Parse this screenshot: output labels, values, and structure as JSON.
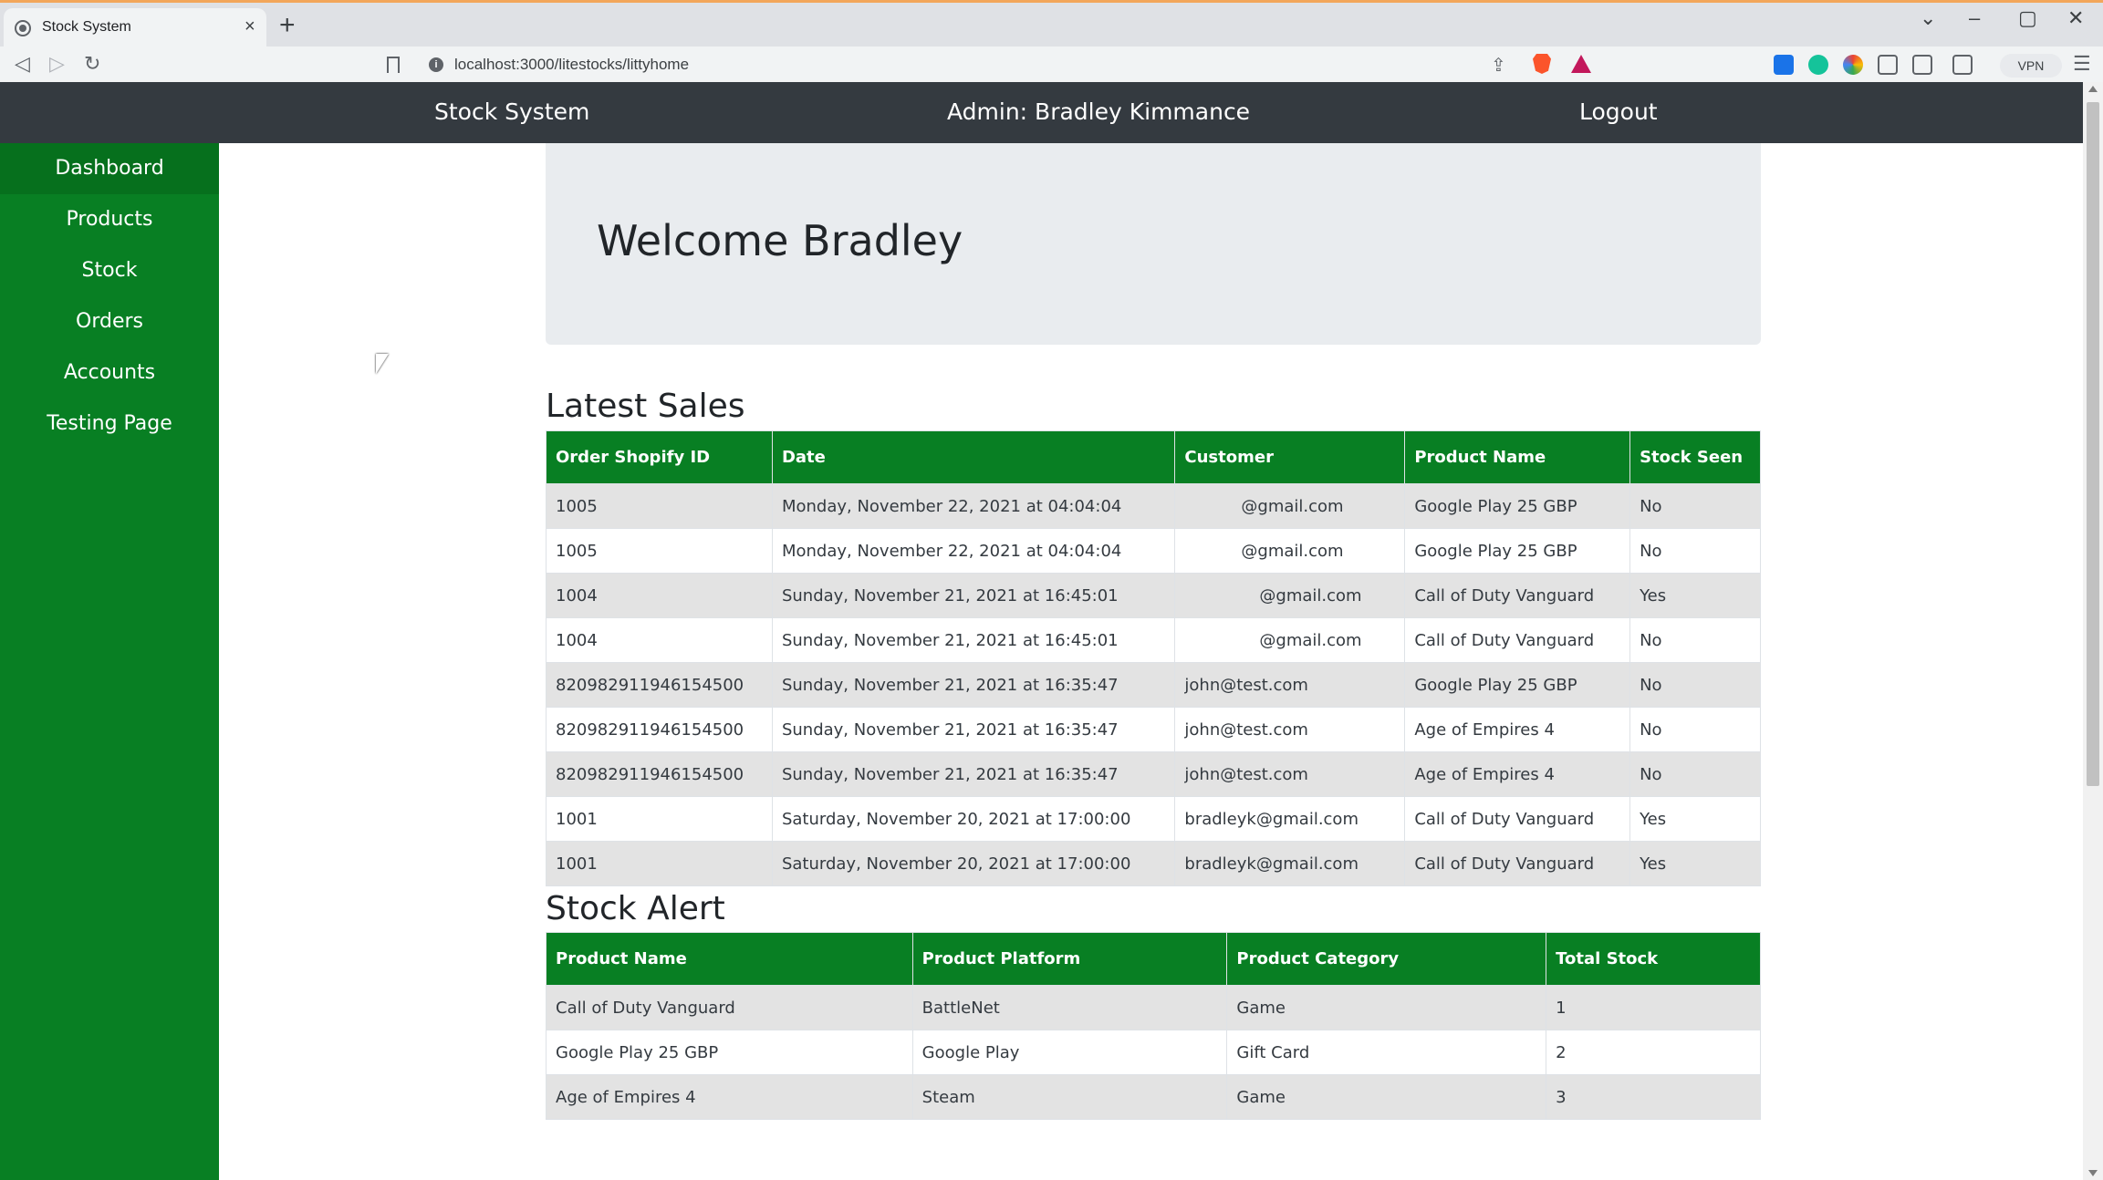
{
  "browser": {
    "tab_title": "Stock System",
    "url": "localhost:3000/litestocks/littyhome",
    "vpn_label": "VPN",
    "new_tab_glyph": "+",
    "tab_close_glyph": "×"
  },
  "header": {
    "brand": "Stock System",
    "admin": "Admin: Bradley Kimmance",
    "logout": "Logout"
  },
  "sidebar": {
    "items": [
      {
        "label": "Dashboard"
      },
      {
        "label": "Products"
      },
      {
        "label": "Stock"
      },
      {
        "label": "Orders"
      },
      {
        "label": "Accounts"
      },
      {
        "label": "Testing Page"
      }
    ],
    "active_index": 0
  },
  "welcome": "Welcome Bradley",
  "latest_sales": {
    "title": "Latest Sales",
    "columns": [
      "Order Shopify ID",
      "Date",
      "Customer",
      "Product Name",
      "Stock Seen"
    ],
    "rows": [
      {
        "id": "1005",
        "date": "Monday, November 22, 2021 at 04:04:04",
        "customer": "@gmail.com",
        "product": "Google Play 25 GBP",
        "seen": "No"
      },
      {
        "id": "1005",
        "date": "Monday, November 22, 2021 at 04:04:04",
        "customer": "@gmail.com",
        "product": "Google Play 25 GBP",
        "seen": "No"
      },
      {
        "id": "1004",
        "date": "Sunday, November 21, 2021 at 16:45:01",
        "customer": "@gmail.com",
        "product": "Call of Duty Vanguard",
        "seen": "Yes"
      },
      {
        "id": "1004",
        "date": "Sunday, November 21, 2021 at 16:45:01",
        "customer": "@gmail.com",
        "product": "Call of Duty Vanguard",
        "seen": "No"
      },
      {
        "id": "820982911946154500",
        "date": "Sunday, November 21, 2021 at 16:35:47",
        "customer": "john@test.com",
        "product": "Google Play 25 GBP",
        "seen": "No"
      },
      {
        "id": "820982911946154500",
        "date": "Sunday, November 21, 2021 at 16:35:47",
        "customer": "john@test.com",
        "product": "Age of Empires 4",
        "seen": "No"
      },
      {
        "id": "820982911946154500",
        "date": "Sunday, November 21, 2021 at 16:35:47",
        "customer": "john@test.com",
        "product": "Age of Empires 4",
        "seen": "No"
      },
      {
        "id": "1001",
        "date": "Saturday, November 20, 2021 at 17:00:00",
        "customer": "bradleyk@gmail.com",
        "product": "Call of Duty Vanguard",
        "seen": "Yes"
      },
      {
        "id": "1001",
        "date": "Saturday, November 20, 2021 at 17:00:00",
        "customer": "bradleyk@gmail.com",
        "product": "Call of Duty Vanguard",
        "seen": "Yes"
      }
    ]
  },
  "stock_alert": {
    "title": "Stock Alert",
    "columns": [
      "Product Name",
      "Product Platform",
      "Product Category",
      "Total Stock"
    ],
    "rows": [
      {
        "name": "Call of Duty Vanguard",
        "platform": "BattleNet",
        "category": "Game",
        "total": "1"
      },
      {
        "name": "Google Play 25 GBP",
        "platform": "Google Play",
        "category": "Gift Card",
        "total": "2"
      },
      {
        "name": "Age of Empires 4",
        "platform": "Steam",
        "category": "Game",
        "total": "3"
      }
    ]
  },
  "colors": {
    "header_bg": "#343a40",
    "sidebar_bg": "#087f23",
    "table_header_bg": "#087f23",
    "jumbotron_bg": "#e9ecef"
  }
}
